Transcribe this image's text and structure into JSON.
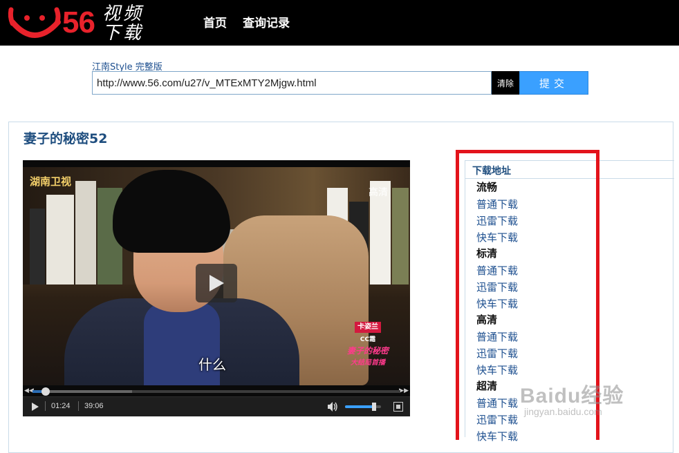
{
  "header": {
    "logo_number": "56",
    "logo_cjk": [
      "视",
      "频",
      "下",
      "载"
    ],
    "nav": [
      {
        "label": "首页"
      },
      {
        "label": "查询记录"
      }
    ]
  },
  "search": {
    "hint_link": "江南Style 完整版",
    "url_value": "http://www.56.com/u27/v_MTExMTY2Mjgw.html",
    "clear_label": "清除",
    "submit_label": "提交"
  },
  "video": {
    "title": "妻子的秘密52",
    "channel_logo": "湖南卫视",
    "quality_tag": "高清",
    "subtitle": "什么",
    "ad_badge_line1": "卡姿兰",
    "ad_badge_line2": "CC霜",
    "ad_badge_line3": "妻子的秘密",
    "ad_badge_line4": "大结局首播",
    "time_current": "01:24",
    "time_total": "39:06",
    "progress_fraction": 0.036,
    "buffered_fraction": 0.27,
    "volume_fraction": 0.8
  },
  "downloads": {
    "header": "下载地址",
    "groups": [
      {
        "title": "流畅",
        "links": [
          "普通下载",
          "迅雷下载",
          "快车下载"
        ]
      },
      {
        "title": "标清",
        "links": [
          "普通下载",
          "迅雷下载",
          "快车下载"
        ]
      },
      {
        "title": "高清",
        "links": [
          "普通下载",
          "迅雷下载",
          "快车下载"
        ]
      },
      {
        "title": "超清",
        "links": [
          "普通下载",
          "迅雷下载",
          "快车下载"
        ]
      }
    ]
  },
  "watermark": {
    "main": "Baidu经验",
    "sub": "jingyan.baidu.com"
  },
  "colors": {
    "accent": "#3aa0ff",
    "brand_red": "#e8222b",
    "highlight_red": "#e3131b",
    "link_blue": "#1d4f8f"
  }
}
